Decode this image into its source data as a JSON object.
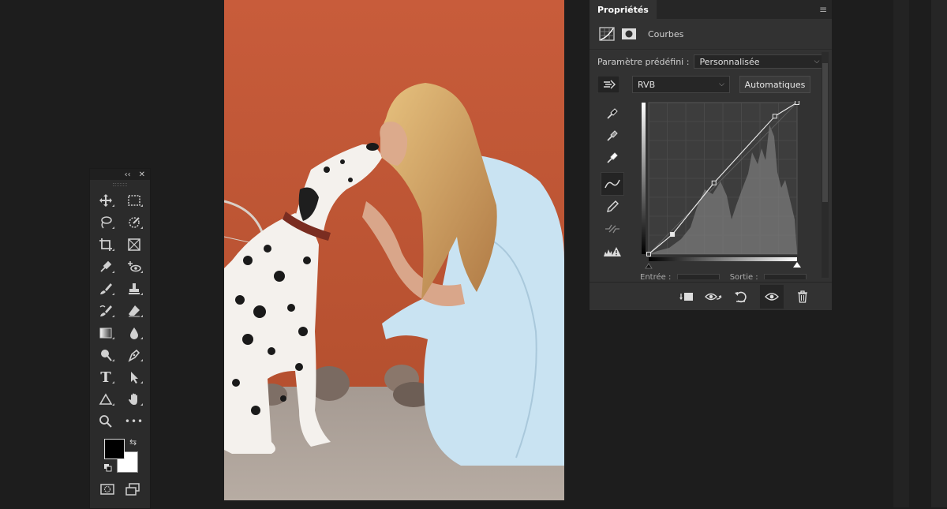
{
  "colors": {
    "app_bg": "#1d1d1d",
    "panel_bg": "#323232",
    "wall": "#c75a3a",
    "dress": "#c9e3f2"
  },
  "tools_panel": {
    "collapse_glyph": "‹‹",
    "close_glyph": "✕",
    "tools": [
      {
        "name": "move-tool",
        "icon": "move-icon"
      },
      {
        "name": "marquee-tool",
        "icon": "rect-marquee-icon"
      },
      {
        "name": "lasso-tool",
        "icon": "lasso-icon"
      },
      {
        "name": "quick-selection-tool",
        "icon": "quick-select-icon"
      },
      {
        "name": "crop-tool",
        "icon": "crop-icon"
      },
      {
        "name": "frame-tool",
        "icon": "frame-icon"
      },
      {
        "name": "eyedropper-tool",
        "icon": "eyedropper-icon"
      },
      {
        "name": "red-eye-tool",
        "icon": "red-eye-icon"
      },
      {
        "name": "brush-tool",
        "icon": "brush-icon"
      },
      {
        "name": "stamp-tool",
        "icon": "stamp-icon"
      },
      {
        "name": "history-brush-tool",
        "icon": "history-brush-icon"
      },
      {
        "name": "eraser-tool",
        "icon": "eraser-icon"
      },
      {
        "name": "gradient-tool",
        "icon": "gradient-icon"
      },
      {
        "name": "blur-tool",
        "icon": "drop-icon"
      },
      {
        "name": "dodge-tool",
        "icon": "dodge-icon"
      },
      {
        "name": "pen-tool",
        "icon": "pen-icon"
      },
      {
        "name": "type-tool",
        "icon": "type-icon"
      },
      {
        "name": "path-selection-tool",
        "icon": "arrow-icon"
      },
      {
        "name": "shape-tool",
        "icon": "triangle-icon"
      },
      {
        "name": "hand-tool",
        "icon": "hand-icon"
      },
      {
        "name": "zoom-tool",
        "icon": "zoom-icon"
      },
      {
        "name": "more-tools",
        "icon": "ellipsis-icon"
      }
    ],
    "type_glyph": "T",
    "more_glyph": "•••",
    "foreground_color": "#000000",
    "background_color": "#ffffff"
  },
  "properties": {
    "tab_label": "Propriétés",
    "menu_glyph": "≡",
    "adjustment_label": "Courbes",
    "preset_label": "Paramètre prédéfini :",
    "preset_value": "Personnalisée",
    "channel_value": "RVB",
    "auto_button": "Automatiques",
    "input_label": "Entrée :",
    "output_label": "Sortie :",
    "curve_points": [
      [
        0,
        0
      ],
      [
        0.16,
        0.13
      ],
      [
        0.44,
        0.47
      ],
      [
        0.85,
        0.91
      ],
      [
        1,
        1
      ]
    ]
  }
}
